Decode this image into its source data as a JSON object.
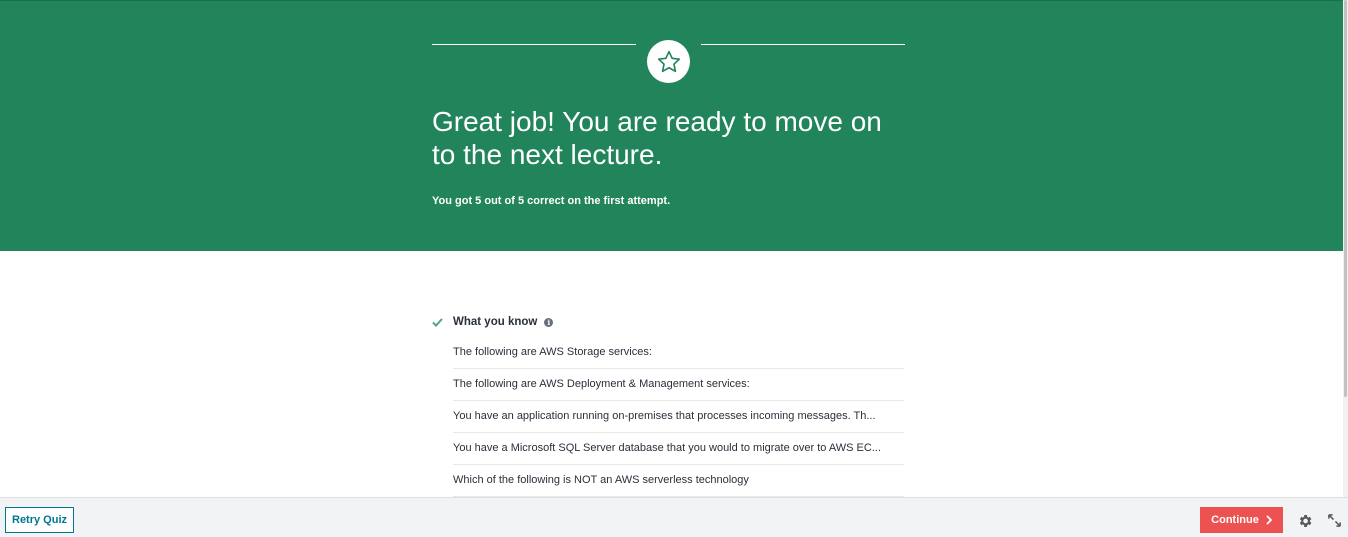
{
  "hero": {
    "title": "Great job! You are ready to move on to the next lecture.",
    "subtitle": "You got 5 out of 5 correct on the first attempt.",
    "icon": "star-icon"
  },
  "knowledge": {
    "title": "What you know",
    "items": [
      "The following are AWS Storage services:",
      "The following are AWS Deployment & Management services:",
      "You have an application running on-premises that processes incoming messages. Th...",
      "You have a Microsoft SQL Server database that you would to migrate over to AWS EC...",
      "Which of the following is NOT an AWS serverless technology"
    ]
  },
  "footer": {
    "retry_label": "Retry Quiz",
    "continue_label": "Continue"
  },
  "colors": {
    "hero_bg": "#21845b",
    "accent_teal": "#007791",
    "continue_red": "#ec5252",
    "check_green": "#4aa87c"
  },
  "icons": [
    "star-icon",
    "check-icon",
    "info-icon",
    "chevron-right-icon",
    "gear-icon",
    "expand-icon"
  ]
}
